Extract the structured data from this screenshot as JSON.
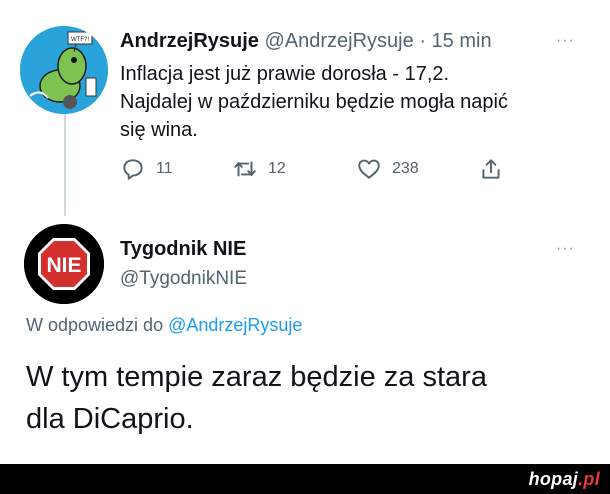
{
  "tweet1": {
    "name": "AndrzejRysuje",
    "handle": "@AndrzejRysuje",
    "dot": "·",
    "time": "15 min",
    "more": "···",
    "lines": [
      "Inflacja jest już prawie dorosła - 17,2.",
      "Najdalej w październiku będzie mogła napić",
      "się wina."
    ],
    "avatar_sign": "WTF?!",
    "actions": {
      "replies": "11",
      "retweets": "12",
      "likes": "238"
    }
  },
  "tweet2": {
    "name": "Tygodnik NIE",
    "handle": "@TygodnikNIE",
    "more": "···",
    "avatar_text": "NIE",
    "reply_prefix": "W odpowiedzi do",
    "reply_handle": "@AndrzejRysuje",
    "lines": [
      "W tym tempie zaraz będzie za stara",
      "dla DiCaprio."
    ]
  },
  "footer": {
    "brand_main": "hopaj",
    "brand_ext": ".pl"
  },
  "colors": {
    "accent": "#1d9bf0",
    "muted": "#536471",
    "stop_red": "#d32f2f",
    "avatar_bg": "#29a3da"
  }
}
